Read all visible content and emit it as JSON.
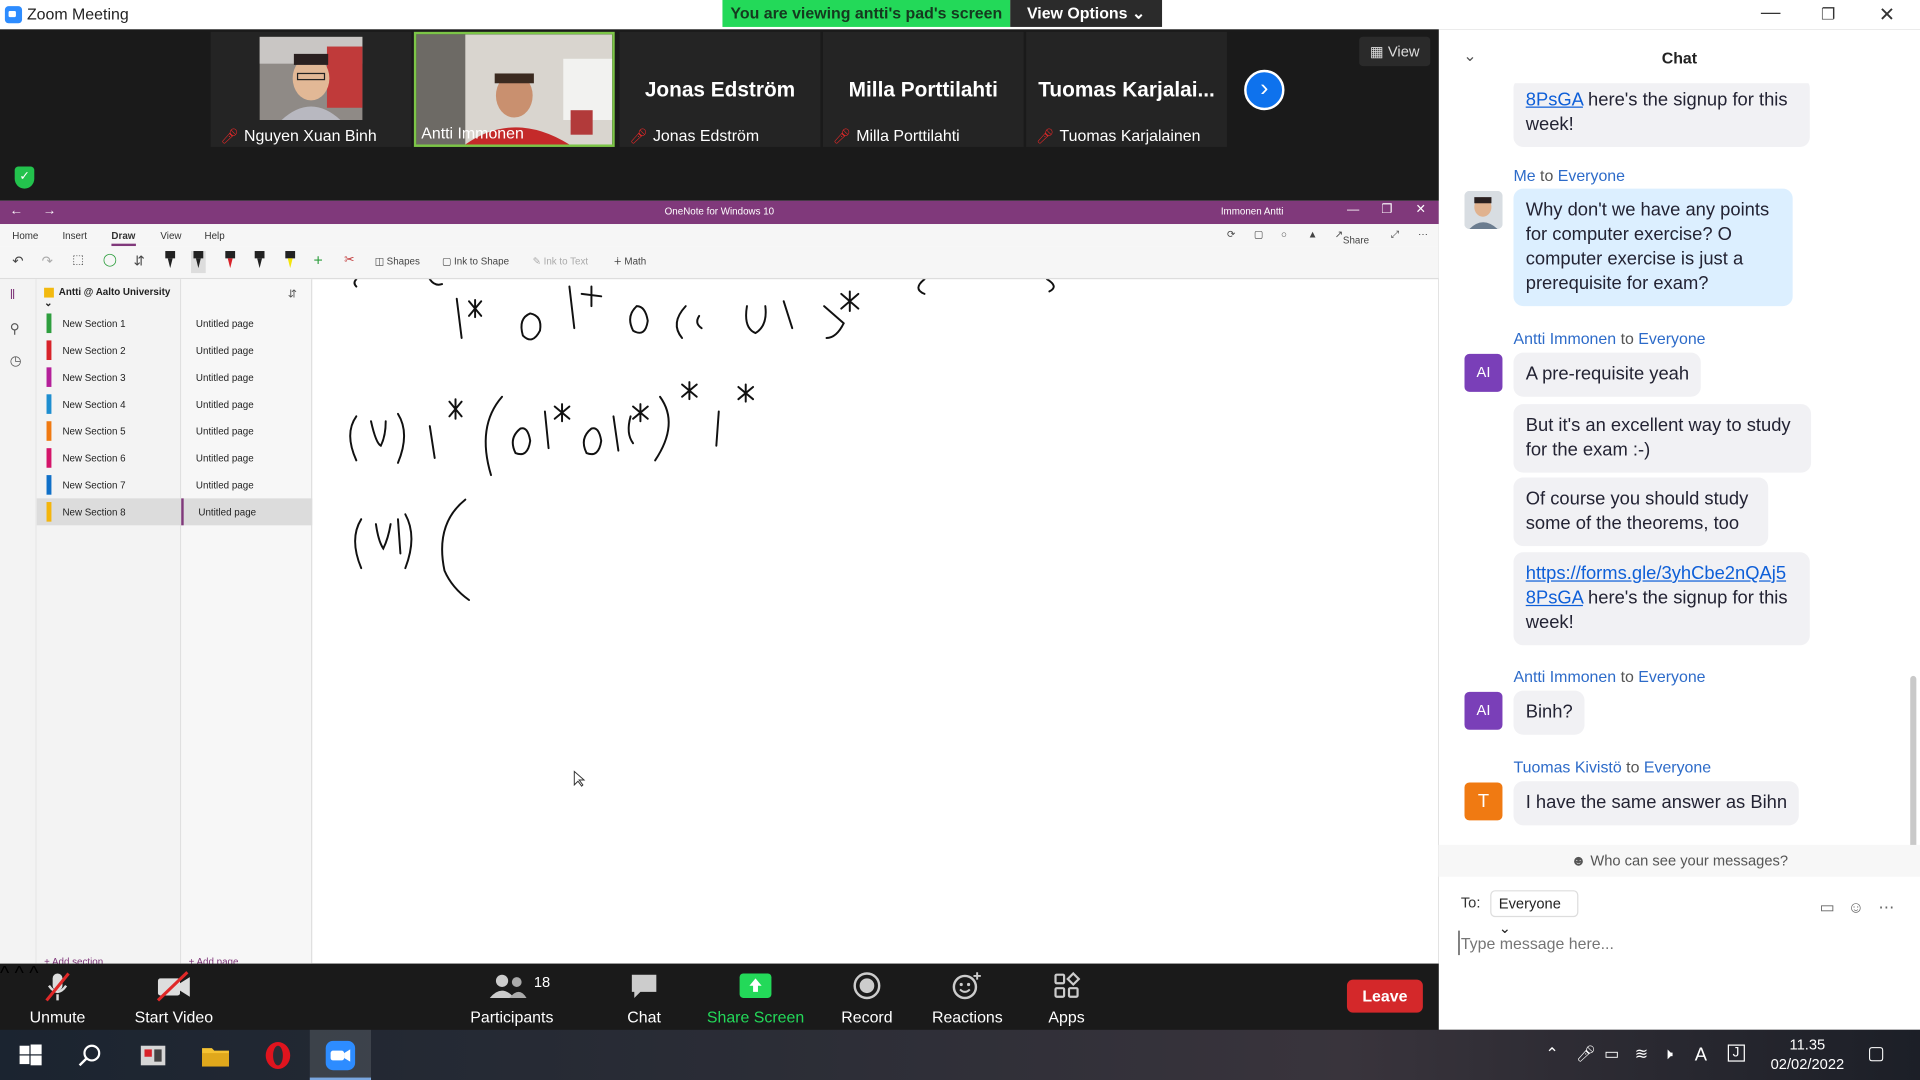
{
  "window": {
    "title": "Zoom Meeting",
    "share_banner": "You are viewing antti's pad's screen",
    "view_options": "View Options"
  },
  "video": {
    "view_label": "View",
    "tiles": [
      {
        "name": "Nguyen Xuan Binh",
        "big": ""
      },
      {
        "name": "Antti Immonen",
        "big": ""
      },
      {
        "name": "Jonas Edström",
        "big": "Jonas Edström"
      },
      {
        "name": "Milla Porttilahti",
        "big": "Milla Porttilahti"
      },
      {
        "name": "Tuomas Karjalainen",
        "big": "Tuomas  Karjalai..."
      }
    ]
  },
  "onenote": {
    "title": "OneNote for Windows 10",
    "user": "Immonen Antti",
    "tabs": [
      "Home",
      "Insert",
      "Draw",
      "View",
      "Help"
    ],
    "share": "Share",
    "tools": {
      "shapes": "Shapes",
      "ink_to_shape": "Ink to Shape",
      "ink_to_text": "Ink to Text",
      "math": "Math"
    },
    "notebook": "Antti @ Aalto University",
    "sections": [
      {
        "name": "New Section 1",
        "color": "#2e9e3e"
      },
      {
        "name": "New Section 2",
        "color": "#d8232a"
      },
      {
        "name": "New Section 3",
        "color": "#b4209a"
      },
      {
        "name": "New Section 4",
        "color": "#1e8ed0"
      },
      {
        "name": "New Section 5",
        "color": "#f07a12"
      },
      {
        "name": "New Section 6",
        "color": "#d4156a"
      },
      {
        "name": "New Section 7",
        "color": "#1070c8"
      },
      {
        "name": "New Section 8",
        "color": "#f4b50c"
      }
    ],
    "pages": [
      "Untitled page",
      "Untitled page",
      "Untitled page",
      "Untitled page",
      "Untitled page",
      "Untitled page",
      "Untitled page",
      "Untitled page"
    ],
    "add_section": "+ Add section",
    "add_page": "+ Add page"
  },
  "toolbar": {
    "unmute": "Unmute",
    "start_video": "Start Video",
    "participants": "Participants",
    "participants_count": "18",
    "chat": "Chat",
    "share_screen": "Share Screen",
    "record": "Record",
    "reactions": "Reactions",
    "apps": "Apps",
    "leave": "Leave"
  },
  "chat": {
    "title": "Chat",
    "messages": {
      "m0": {
        "text_link": "8PsGA",
        "text": " here's the signup for this week!"
      },
      "m1": {
        "sender": "Me",
        "to": "to",
        "recipient": "Everyone",
        "text": "Why don't we have any points for computer exercise? O computer exercise is just a prerequisite for exam?"
      },
      "m2": {
        "sender": "Antti Immonen",
        "to": "to",
        "recipient": "Everyone",
        "avatar": "AI",
        "text": "A pre-requisite yeah"
      },
      "m3": {
        "text": "But it's an excellent way to study for the exam :-)"
      },
      "m4": {
        "text": "Of course you should study some of the theorems, too"
      },
      "m5": {
        "link": "https://forms.gle/3yhCbe2nQAj5 8PsGA",
        "text": " here's the signup for this week!"
      },
      "m6": {
        "sender": "Antti Immonen",
        "to": "to",
        "recipient": "Everyone",
        "avatar": "AI",
        "text": "Binh?"
      },
      "m7": {
        "sender": "Tuomas Kivistö",
        "to": "to",
        "recipient": "Everyone",
        "avatar": "T",
        "text": "I have the same answer as Bihn"
      }
    },
    "who_can_see": "Who can see your messages?",
    "to_label": "To:",
    "to_value": "Everyone",
    "placeholder": "Type message here..."
  },
  "taskbar": {
    "time": "11.35",
    "date": "02/02/2022"
  },
  "colors": {
    "onenote_purple": "#80397b",
    "zoom_blue": "#0e72ed",
    "leave_red": "#d4282a",
    "share_green": "#23d959"
  }
}
